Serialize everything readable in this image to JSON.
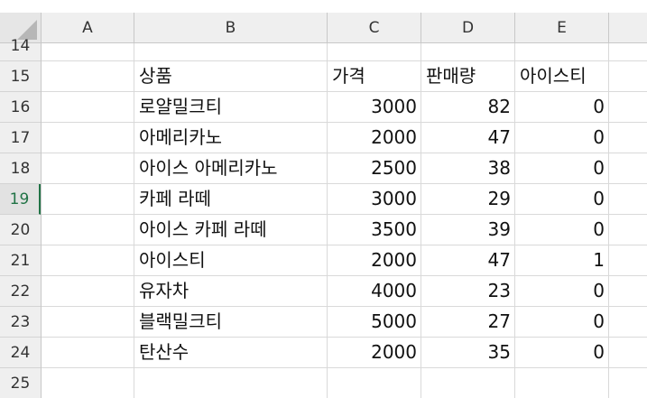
{
  "columns": [
    "A",
    "B",
    "C",
    "D",
    "E"
  ],
  "rows": [
    {
      "num": "14",
      "cells": [
        "",
        "",
        "",
        "",
        ""
      ]
    },
    {
      "num": "15",
      "cells": [
        "",
        "상품",
        "가격",
        "판매량",
        "아이스티"
      ]
    },
    {
      "num": "16",
      "cells": [
        "",
        "로얄밀크티",
        "3000",
        "82",
        "0"
      ]
    },
    {
      "num": "17",
      "cells": [
        "",
        "아메리카노",
        "2000",
        "47",
        "0"
      ]
    },
    {
      "num": "18",
      "cells": [
        "",
        "아이스 아메리카노",
        "2500",
        "38",
        "0"
      ]
    },
    {
      "num": "19",
      "cells": [
        "",
        "카페 라떼",
        "3000",
        "29",
        "0"
      ]
    },
    {
      "num": "20",
      "cells": [
        "",
        "아이스 카페 라떼",
        "3500",
        "39",
        "0"
      ]
    },
    {
      "num": "21",
      "cells": [
        "",
        "아이스티",
        "2000",
        "47",
        "1"
      ]
    },
    {
      "num": "22",
      "cells": [
        "",
        "유자차",
        "4000",
        "23",
        "0"
      ]
    },
    {
      "num": "23",
      "cells": [
        "",
        "블랙밀크티",
        "5000",
        "27",
        "0"
      ]
    },
    {
      "num": "24",
      "cells": [
        "",
        "탄산수",
        "2000",
        "35",
        "0"
      ]
    },
    {
      "num": "25",
      "cells": [
        "",
        "",
        "",
        "",
        ""
      ]
    }
  ],
  "active_row": "19",
  "numeric_alignment": [
    false,
    false,
    true,
    true,
    true
  ],
  "colors": {
    "accent": "#217346",
    "header_bg": "#efefef",
    "gridline": "#d9d9d9"
  }
}
